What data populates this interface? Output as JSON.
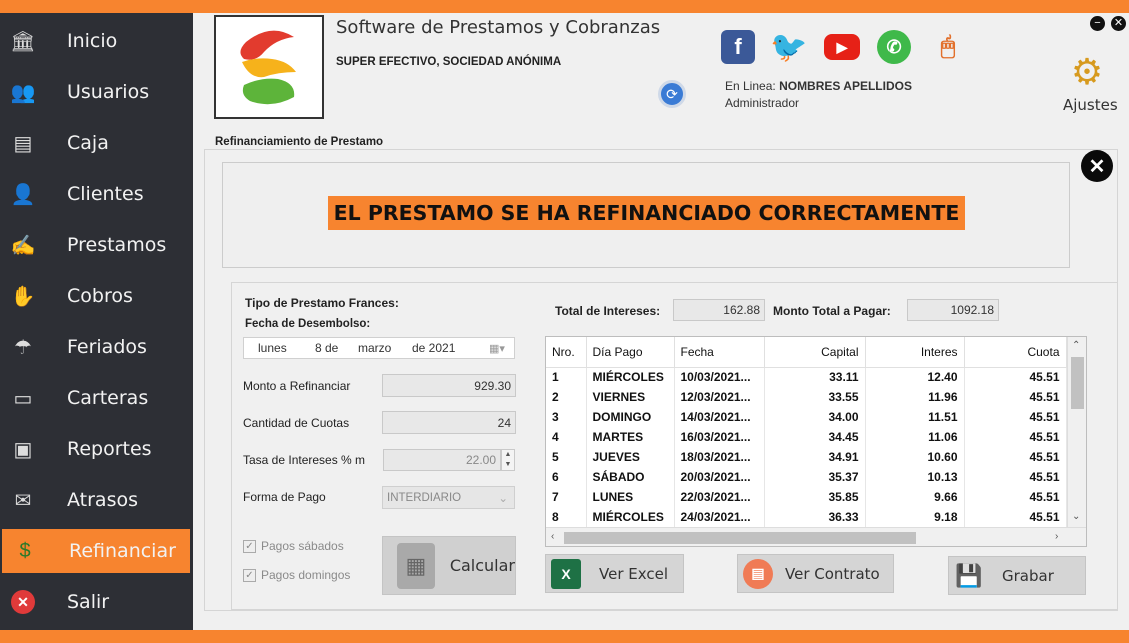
{
  "colors": {
    "accent": "#f7842f",
    "sidebar": "#2d2f35"
  },
  "sidebar": {
    "items": [
      {
        "label": "Inicio",
        "icon": "bank-icon"
      },
      {
        "label": "Usuarios",
        "icon": "users-icon"
      },
      {
        "label": "Caja",
        "icon": "cash-register-icon"
      },
      {
        "label": "Clientes",
        "icon": "clients-icon"
      },
      {
        "label": "Prestamos",
        "icon": "loan-icon"
      },
      {
        "label": "Cobros",
        "icon": "collection-icon"
      },
      {
        "label": "Feriados",
        "icon": "beach-icon"
      },
      {
        "label": "Carteras",
        "icon": "wallet-icon"
      },
      {
        "label": "Reportes",
        "icon": "report-icon"
      },
      {
        "label": "Atrasos",
        "icon": "late-money-icon"
      },
      {
        "label": "Refinanciar",
        "icon": "refinance-icon",
        "active": true
      },
      {
        "label": "Salir",
        "icon": "exit-icon"
      }
    ]
  },
  "header": {
    "app_title": "Software de Prestamos y Cobranzas",
    "company": "SUPER EFECTIVO, SOCIEDAD ANÓNIMA",
    "online_prefix": "En Linea:",
    "user_name": "NOMBRES APELLIDOS",
    "role": "Administrador",
    "settings_label": "Ajustes"
  },
  "panel": {
    "group_title": "Refinanciamiento de Prestamo",
    "success_message": "EL PRESTAMO SE HA REFINANCIADO CORRECTAMENTE"
  },
  "form": {
    "tipo_label": "Tipo de Prestamo Frances:",
    "fecha_label": "Fecha de Desembolso:",
    "date": {
      "day_name": "lunes",
      "day": "8 de",
      "month": "marzo",
      "year": "de 2021"
    },
    "monto_label": "Monto a Refinanciar",
    "monto_value": "929.30",
    "cuotas_label": "Cantidad de Cuotas",
    "cuotas_value": "24",
    "tasa_label": "Tasa de Intereses % m",
    "tasa_value": "22.00",
    "forma_label": "Forma de Pago",
    "forma_value": "INTERDIARIO",
    "sabados_label": "Pagos sábados",
    "domingos_label": "Pagos domingos",
    "calcular_label": "Calcular"
  },
  "totals": {
    "intereses_label": "Total de Intereses:",
    "intereses_value": "162.88",
    "total_label": "Monto Total a Pagar:",
    "total_value": "1092.18"
  },
  "table": {
    "headers": [
      "Nro.",
      "Día Pago",
      "Fecha",
      "Capital",
      "Interes",
      "Cuota"
    ],
    "rows": [
      [
        "1",
        "MIÉRCOLES",
        "10/03/2021...",
        "33.11",
        "12.40",
        "45.51"
      ],
      [
        "2",
        "VIERNES",
        "12/03/2021...",
        "33.55",
        "11.96",
        "45.51"
      ],
      [
        "3",
        "DOMINGO",
        "14/03/2021...",
        "34.00",
        "11.51",
        "45.51"
      ],
      [
        "4",
        "MARTES",
        "16/03/2021...",
        "34.45",
        "11.06",
        "45.51"
      ],
      [
        "5",
        "JUEVES",
        "18/03/2021...",
        "34.91",
        "10.60",
        "45.51"
      ],
      [
        "6",
        "SÁBADO",
        "20/03/2021...",
        "35.37",
        "10.13",
        "45.51"
      ],
      [
        "7",
        "LUNES",
        "22/03/2021...",
        "35.85",
        "9.66",
        "45.51"
      ],
      [
        "8",
        "MIÉRCOLES",
        "24/03/2021...",
        "36.33",
        "9.18",
        "45.51"
      ]
    ]
  },
  "actions": {
    "excel_label": "Ver Excel",
    "contrato_label": "Ver Contrato",
    "grabar_label": "Grabar"
  }
}
